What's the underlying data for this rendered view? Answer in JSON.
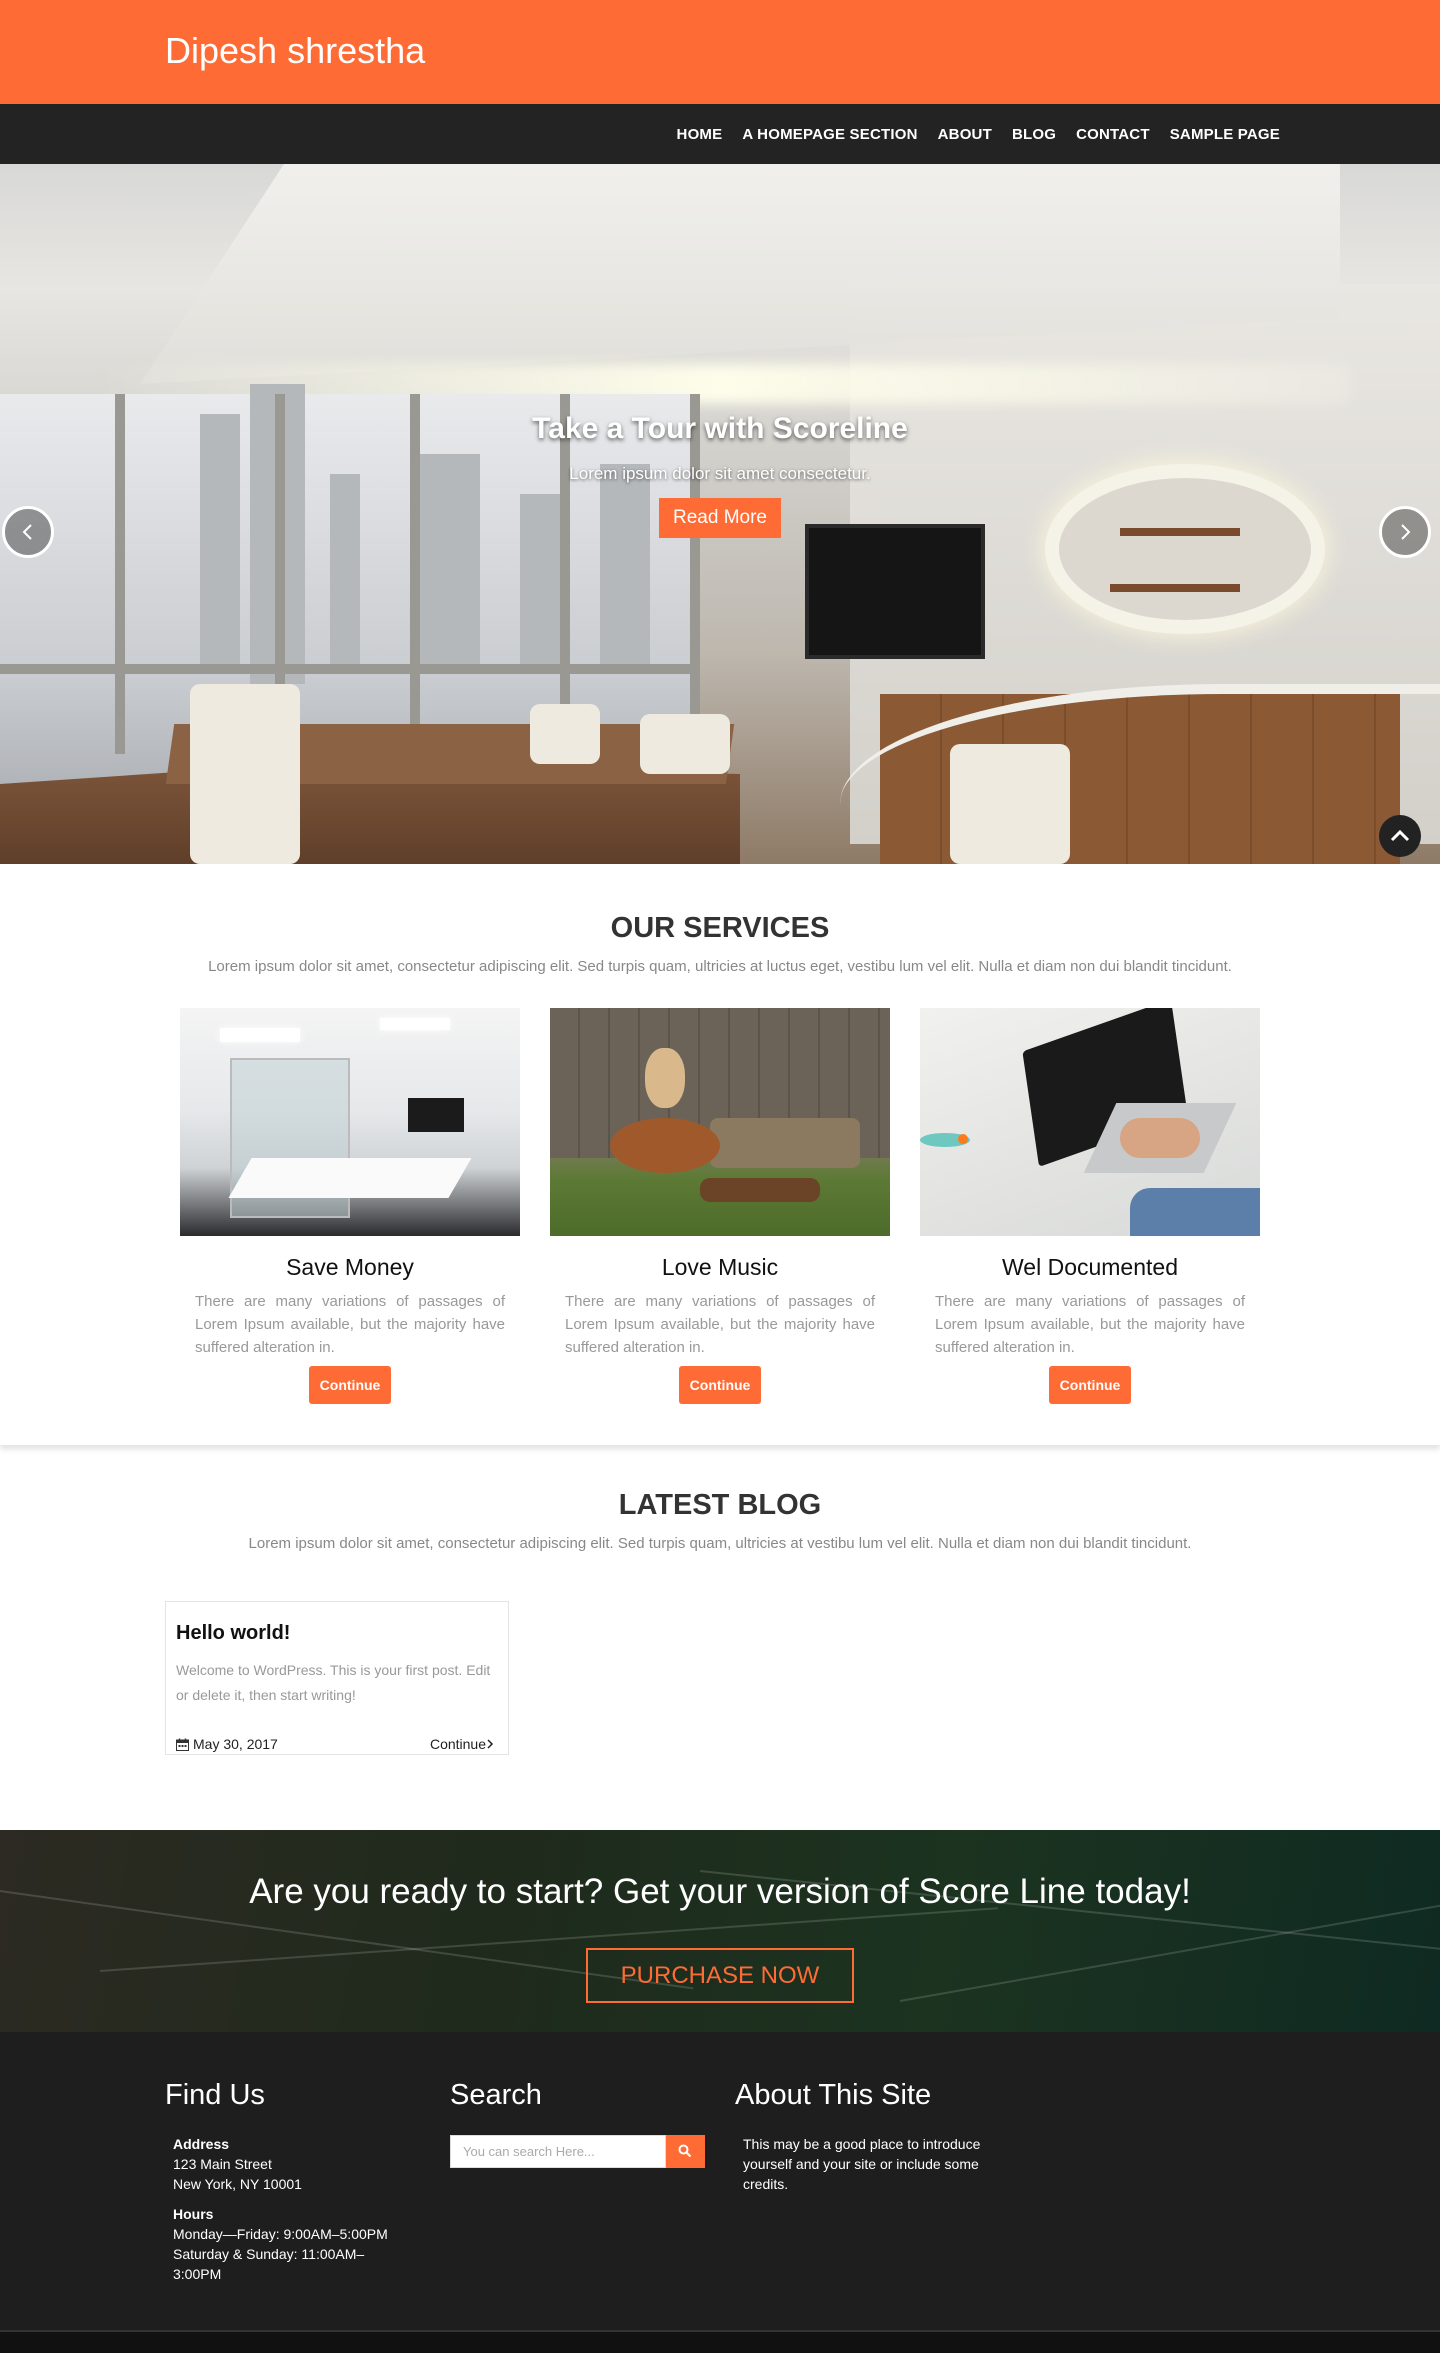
{
  "header": {
    "site_title": "Dipesh shrestha"
  },
  "nav": {
    "items": [
      "HOME",
      "A HOMEPAGE SECTION",
      "ABOUT",
      "BLOG",
      "CONTACT",
      "SAMPLE PAGE"
    ]
  },
  "hero": {
    "title": "Take a Tour with Scoreline",
    "subtitle": "Lorem ipsum dolor sit amet consectetur.",
    "button": "Read More"
  },
  "services": {
    "title": "OUR SERVICES",
    "description": "Lorem ipsum dolor sit amet, consectetur adipiscing elit. Sed turpis quam, ultricies at luctus eget, vestibu lum vel elit. Nulla et diam non dui blandit tincidunt.",
    "items": [
      {
        "title": "Save Money",
        "text": "There are many variations of passages of Lorem Ipsum available, but the majority have suffered alteration in.",
        "button": "Continue"
      },
      {
        "title": "Love Music",
        "text": "There are many variations of passages of Lorem Ipsum available, but the majority have suffered alteration in.",
        "button": "Continue"
      },
      {
        "title": "Wel Documented",
        "text": "There are many variations of passages of Lorem Ipsum available, but the majority have suffered alteration in.",
        "button": "Continue"
      }
    ]
  },
  "blog": {
    "title": "LATEST BLOG",
    "description": "Lorem ipsum dolor sit amet, consectetur adipiscing elit. Sed turpis quam, ultricies at vestibu lum vel elit. Nulla et diam non dui blandit tincidunt.",
    "post": {
      "title": "Hello world!",
      "excerpt": "Welcome to WordPress. This is your first post. Edit or delete it, then start writing!",
      "date": "May 30, 2017",
      "more": "Continue"
    }
  },
  "cta": {
    "title": "Are you ready to start? Get your version of Score Line today!",
    "button": "PURCHASE NOW"
  },
  "footer": {
    "find_us": {
      "heading": "Find Us",
      "address_label": "Address",
      "address_line1": "123 Main Street",
      "address_line2": "New York, NY 10001",
      "hours_label": "Hours",
      "hours_line1": "Monday—Friday: 9:00AM–5:00PM",
      "hours_line2": "Saturday & Sunday: 11:00AM–",
      "hours_line3": "3:00PM"
    },
    "search": {
      "heading": "Search",
      "placeholder": "You can search Here..."
    },
    "about": {
      "heading": "About This Site",
      "text": "This may be a good place to introduce yourself and your site or include some credits."
    }
  },
  "colors": {
    "accent": "#ff6b35",
    "nav_bg": "#232323",
    "footer_bg": "#1e1e1e"
  },
  "icons": [
    "chevron-left-icon",
    "chevron-right-icon",
    "chevron-up-icon",
    "calendar-icon",
    "angle-right-icon",
    "search-icon"
  ]
}
